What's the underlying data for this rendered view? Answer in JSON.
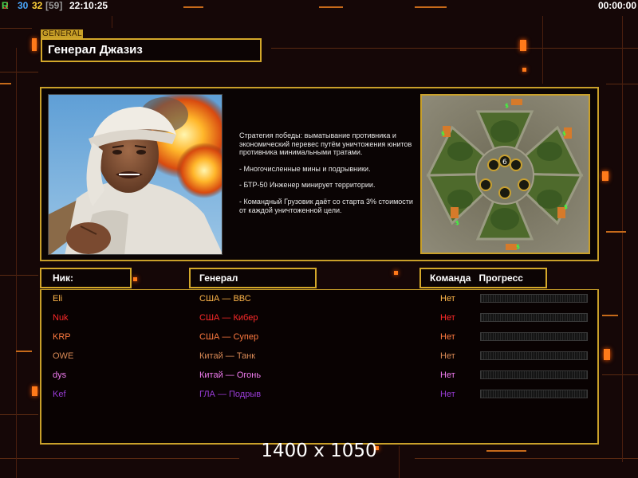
{
  "topbar": {
    "ur_u": "U",
    "ur_r": "R",
    "fps_a": "30",
    "fps_b": "32",
    "fps_c": "[59]",
    "clock": "22:10:25",
    "game_timer": "00:00:00"
  },
  "general": {
    "tag": "GENERAL",
    "name": "Генерал Джазиз",
    "description": [
      "Стратегия победы: выматывание противника и экономический перевес путём уничтожения юнитов противника минимальными тратами.",
      "- Многочисленные мины и подрывники.",
      "- БТР-50 Инженер минирует территории.",
      "- Командный Грузовик даёт со старта 3% стоимости от каждой уничтоженной цели."
    ]
  },
  "map": {
    "start_marker": "6",
    "supply_icon": "$"
  },
  "columns": {
    "nick": "Ник:",
    "general": "Генерал",
    "team": "Команда",
    "progress": "Прогресс"
  },
  "players": [
    {
      "nick": "Eli",
      "general": "США — ВВС",
      "team": "Нет",
      "color": "#ffb64a",
      "progress": 0
    },
    {
      "nick": "Nuk",
      "general": "США — Кибер",
      "team": "Нет",
      "color": "#ff2a2a",
      "progress": 0
    },
    {
      "nick": "KRP",
      "general": "США — Супер",
      "team": "Нет",
      "color": "#ff7a40",
      "progress": 0
    },
    {
      "nick": "OWE",
      "general": "Китай — Танк",
      "team": "Нет",
      "color": "#d98a56",
      "progress": 0
    },
    {
      "nick": "dys",
      "general": "Китай — Огонь",
      "team": "Нет",
      "color": "#f07cf0",
      "progress": 0
    },
    {
      "nick": "Kef",
      "general": "ГЛА — Подрыв",
      "team": "Нет",
      "color": "#9a3cd8",
      "progress": 0
    }
  ],
  "watermark": "1400 x 1050"
}
